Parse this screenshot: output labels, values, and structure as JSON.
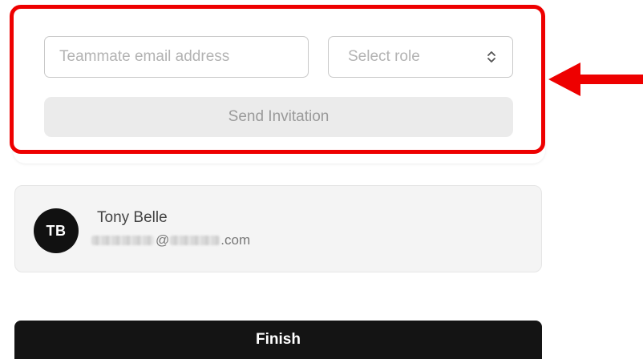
{
  "invite_form": {
    "email_placeholder": "Teammate email address",
    "email_value": "",
    "role_placeholder": "Select role",
    "send_button_label": "Send Invitation"
  },
  "member": {
    "initials": "TB",
    "name": "Tony Belle",
    "email_at": "@",
    "email_suffix": ".com"
  },
  "footer": {
    "finish_label": "Finish"
  },
  "colors": {
    "highlight": "#ee0000",
    "avatar_bg": "#111111",
    "finish_bg": "#141414"
  },
  "icons": {
    "role_select": "chevron-up-down-icon",
    "annotation": "arrow-left-icon"
  }
}
